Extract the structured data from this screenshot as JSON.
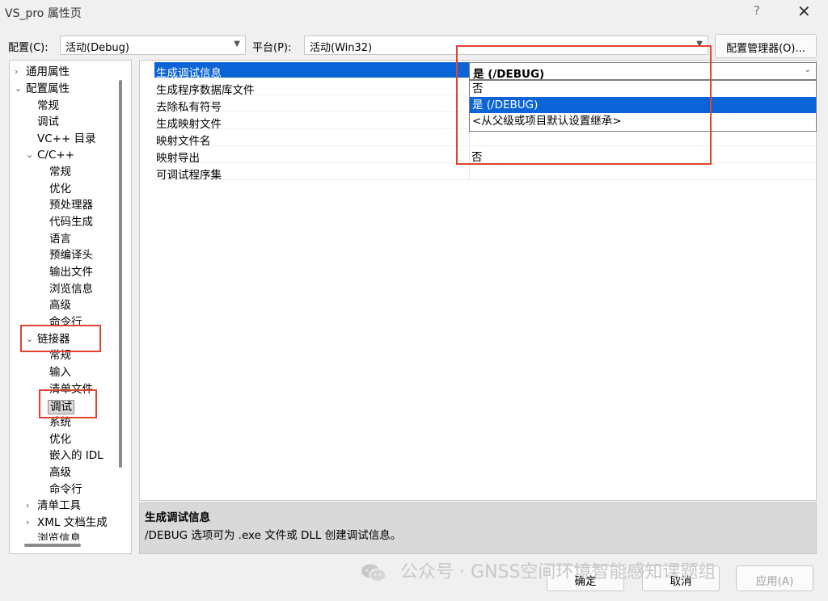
{
  "window": {
    "title": "VS_pro 属性页",
    "help": "?",
    "close": "✕"
  },
  "toolbar": {
    "config_label": "配置(C):",
    "config_value": "活动(Debug)",
    "platform_label": "平台(P):",
    "platform_value": "活动(Win32)",
    "config_manager": "配置管理器(O)..."
  },
  "tree": {
    "items": [
      {
        "label": "通用属性",
        "expander": "›"
      },
      {
        "label": "配置属性",
        "expander": "⌄"
      },
      {
        "label": "常规"
      },
      {
        "label": "调试"
      },
      {
        "label": "VC++ 目录"
      },
      {
        "label": "C/C++",
        "expander": "⌄"
      },
      {
        "label": "常规"
      },
      {
        "label": "优化"
      },
      {
        "label": "预处理器"
      },
      {
        "label": "代码生成"
      },
      {
        "label": "语言"
      },
      {
        "label": "预编译头"
      },
      {
        "label": "输出文件"
      },
      {
        "label": "浏览信息"
      },
      {
        "label": "高级"
      },
      {
        "label": "命令行"
      },
      {
        "label": "链接器",
        "expander": "⌄"
      },
      {
        "label": "常规"
      },
      {
        "label": "输入"
      },
      {
        "label": "清单文件"
      },
      {
        "label": "调试"
      },
      {
        "label": "系统"
      },
      {
        "label": "优化"
      },
      {
        "label": "嵌入的 IDL"
      },
      {
        "label": "高级"
      },
      {
        "label": "命令行"
      },
      {
        "label": "清单工具",
        "expander": "›"
      },
      {
        "label": "XML 文档生成",
        "expander": "›"
      },
      {
        "label": "浏览信息"
      }
    ]
  },
  "grid": {
    "rows": [
      {
        "name": "生成调试信息"
      },
      {
        "name": "生成程序数据库文件"
      },
      {
        "name": "去除私有符号"
      },
      {
        "name": "生成映射文件"
      },
      {
        "name": "映射文件名"
      },
      {
        "name": "映射导出"
      },
      {
        "name": "可调试程序集"
      }
    ],
    "current_value": "是 (/DEBUG)",
    "dropdown_options": [
      "否",
      "是 (/DEBUG)",
      "<从父级或项目默认设置继承>"
    ],
    "map_exports_value": "否"
  },
  "description": {
    "title": "生成调试信息",
    "text": "/DEBUG 选项可为 .exe 文件或 DLL 创建调试信息。"
  },
  "footer": {
    "ok": "确定",
    "cancel": "取消",
    "apply": "应用(A)"
  },
  "watermark": {
    "text": "公众号 · GNSS空间环境智能感知课题组"
  },
  "colors": {
    "selection": "#0a64d8",
    "highlight_box": "#e0432f"
  }
}
